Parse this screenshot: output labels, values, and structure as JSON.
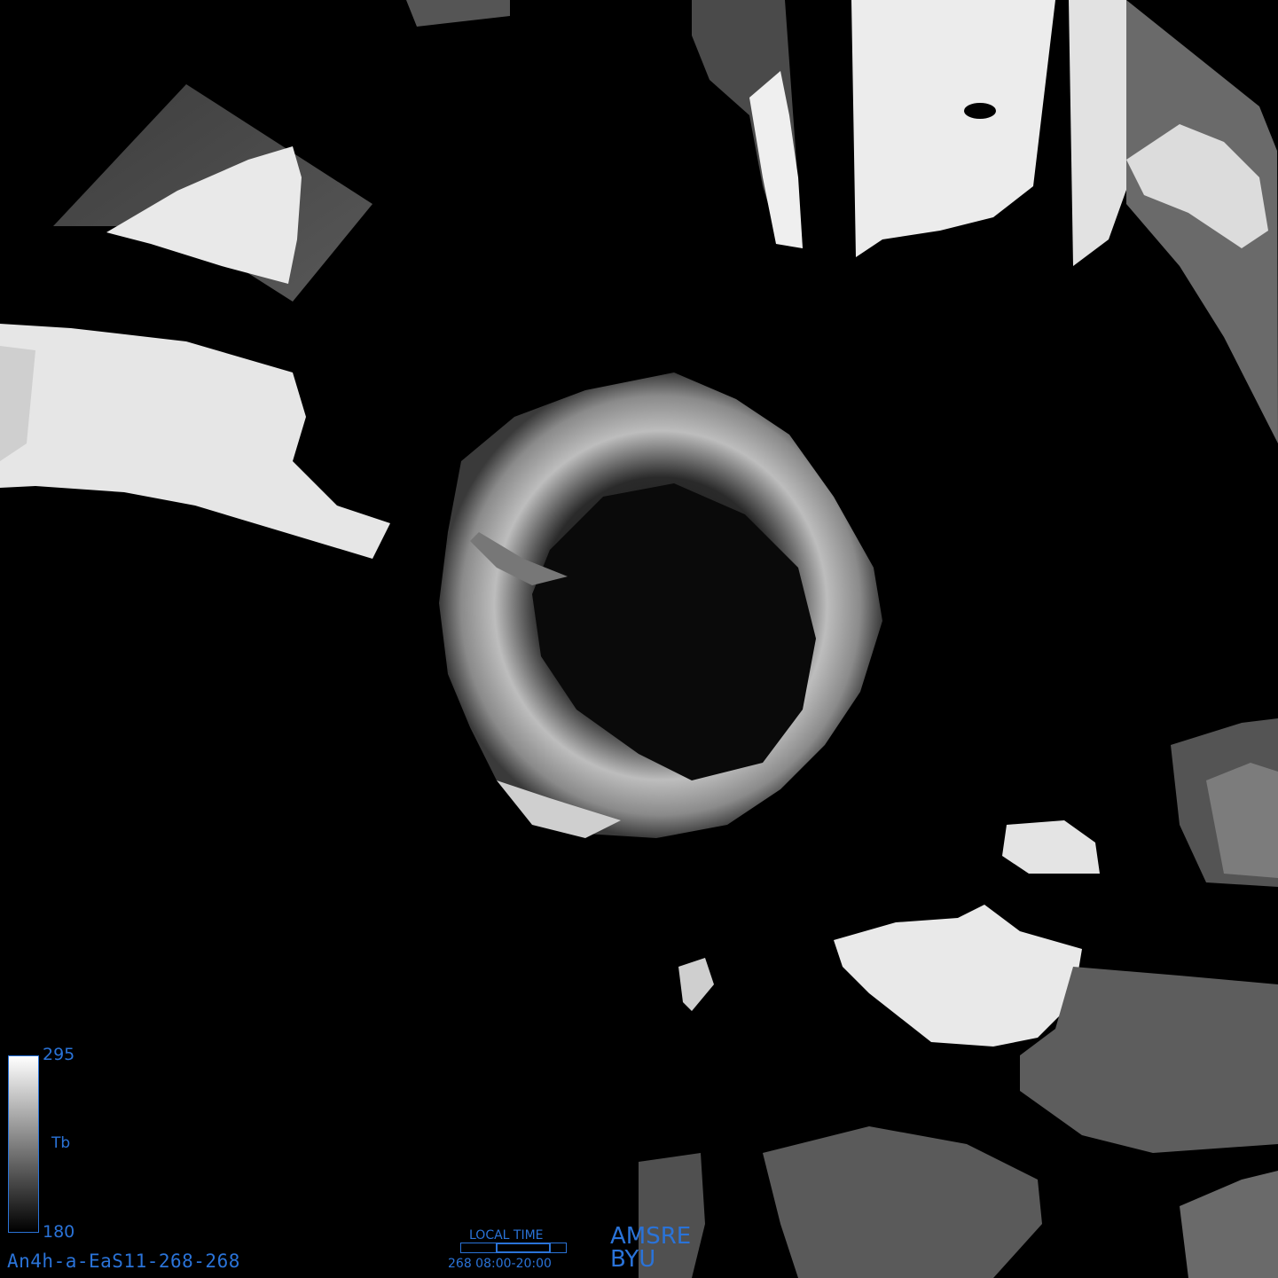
{
  "map": {
    "projection": "south polar stereographic",
    "image": "AMSR-E brightness temperature composite"
  },
  "legend": {
    "max": "295",
    "variable": "Tb",
    "min": "180"
  },
  "product_id": "An4h-a-EaS11-268-268",
  "local_time": {
    "title": "LOCAL TIME",
    "range": "268 08:00-20:00"
  },
  "credits": {
    "sensor": "AMSRE",
    "org": "BYU"
  },
  "colors": {
    "label_blue": "#2a73d8",
    "background": "#000000"
  }
}
